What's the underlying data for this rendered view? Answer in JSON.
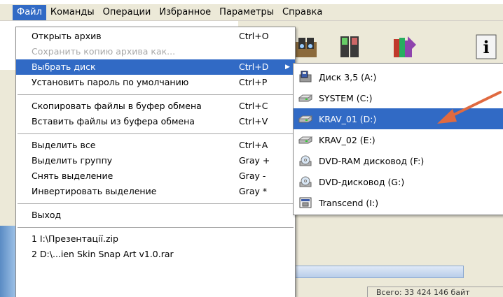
{
  "menubar": {
    "items": [
      "Файл",
      "Команды",
      "Операции",
      "Избранное",
      "Параметры",
      "Справка"
    ]
  },
  "file_menu": {
    "items": [
      {
        "label": "Открыть архив",
        "shortcut": "Ctrl+O"
      },
      {
        "label": "Сохранить копию архива как...",
        "shortcut": ""
      },
      {
        "label": "Выбрать диск",
        "shortcut": "Ctrl+D"
      },
      {
        "label": "Установить пароль по умолчанию",
        "shortcut": "Ctrl+P"
      },
      {
        "label": "Скопировать файлы в буфер обмена",
        "shortcut": "Ctrl+C"
      },
      {
        "label": "Вставить файлы из буфера обмена",
        "shortcut": "Ctrl+V"
      },
      {
        "label": "Выделить все",
        "shortcut": "Ctrl+A"
      },
      {
        "label": "Выделить группу",
        "shortcut": "Gray +"
      },
      {
        "label": "Снять выделение",
        "shortcut": "Gray -"
      },
      {
        "label": "Инвертировать выделение",
        "shortcut": "Gray *"
      },
      {
        "label": "Выход",
        "shortcut": ""
      },
      {
        "label": "1  I:\\Презентації.zip",
        "shortcut": ""
      },
      {
        "label": "2  D:\\...ien Skin Snap Art v1.0.rar",
        "shortcut": ""
      }
    ],
    "submenu_arrow": "▶"
  },
  "drive_submenu": {
    "items": [
      {
        "label": "Диск 3,5 (A:)",
        "icon": "floppy-drive-icon"
      },
      {
        "label": "SYSTEM (C:)",
        "icon": "hard-drive-icon"
      },
      {
        "label": "KRAV_01 (D:)",
        "icon": "hard-drive-icon"
      },
      {
        "label": "KRAV_02 (E:)",
        "icon": "hard-drive-icon"
      },
      {
        "label": "DVD-RAM дисковод (F:)",
        "icon": "dvd-drive-icon"
      },
      {
        "label": "DVD-дисковод (G:)",
        "icon": "dvd-drive-icon"
      },
      {
        "label": "Transcend (I:)",
        "icon": "removable-drive-icon"
      }
    ]
  },
  "status": {
    "text": "Всего: 33 424 146 байт"
  },
  "colors": {
    "highlight": "#316ac5",
    "menubar_bg": "#ece9d8",
    "arrow": "#e06a40"
  }
}
